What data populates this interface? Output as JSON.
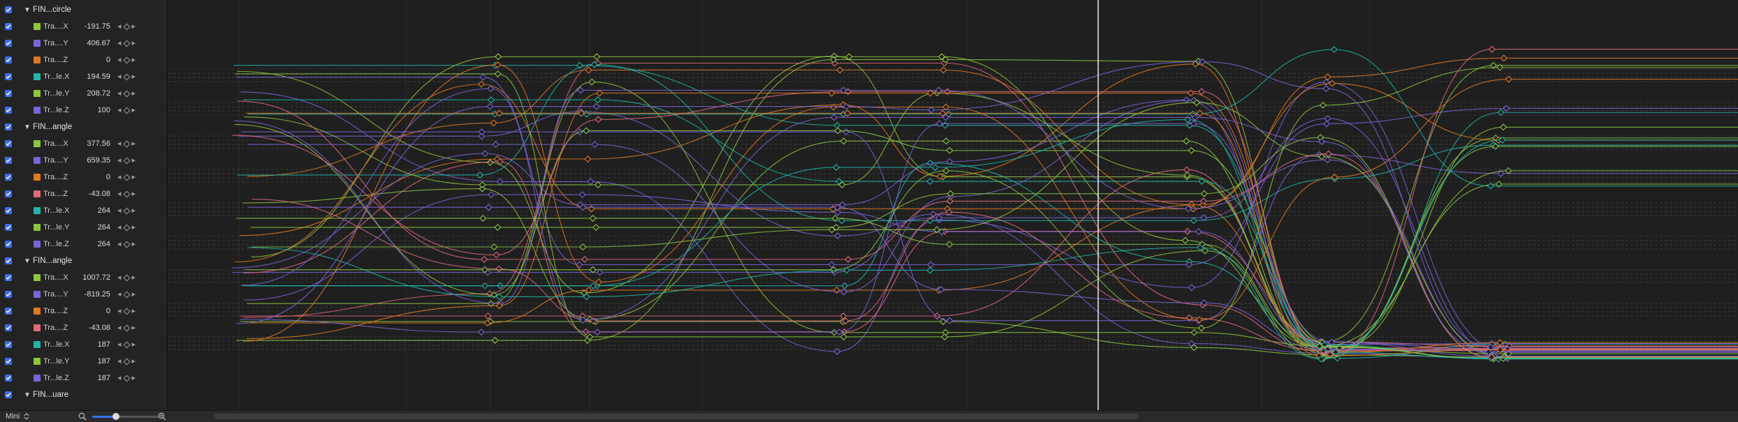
{
  "sidebar": {
    "rows": [
      {
        "kind": "group",
        "label": "FIN...circle"
      },
      {
        "kind": "param",
        "label": "Tra....X",
        "value": "-191.75",
        "color": "#8cc63e"
      },
      {
        "kind": "param",
        "label": "Tra....Y",
        "value": "406.67",
        "color": "#7b63d9"
      },
      {
        "kind": "param",
        "label": "Tra....Z",
        "value": "0",
        "color": "#e07a22"
      },
      {
        "kind": "param",
        "label": "Tr...le.X",
        "value": "194.59",
        "color": "#1fb5a7"
      },
      {
        "kind": "param",
        "label": "Tr...le.Y",
        "value": "208.72",
        "color": "#8cc63e"
      },
      {
        "kind": "param",
        "label": "Tr...le.Z",
        "value": "100",
        "color": "#7b63d9"
      },
      {
        "kind": "group",
        "label": "FIN...angle"
      },
      {
        "kind": "param",
        "label": "Tra....X",
        "value": "377.56",
        "color": "#8cc63e"
      },
      {
        "kind": "param",
        "label": "Tra....Y",
        "value": "659.35",
        "color": "#7b63d9"
      },
      {
        "kind": "param",
        "label": "Tra....Z",
        "value": "0",
        "color": "#e07a22"
      },
      {
        "kind": "param",
        "label": "Tra....Z",
        "value": "-43.08",
        "color": "#e06a7a"
      },
      {
        "kind": "param",
        "label": "Tr...le.X",
        "value": "264",
        "color": "#1fb5a7"
      },
      {
        "kind": "param",
        "label": "Tr...le.Y",
        "value": "264",
        "color": "#8cc63e"
      },
      {
        "kind": "param",
        "label": "Tr...le.Z",
        "value": "264",
        "color": "#7b63d9"
      },
      {
        "kind": "group",
        "label": "FIN...angle"
      },
      {
        "kind": "param",
        "label": "Tra....X",
        "value": "1007.72",
        "color": "#8cc63e"
      },
      {
        "kind": "param",
        "label": "Tra....Y",
        "value": "-819.25",
        "color": "#7b63d9"
      },
      {
        "kind": "param",
        "label": "Tra....Z",
        "value": "0",
        "color": "#e07a22"
      },
      {
        "kind": "param",
        "label": "Tra....Z",
        "value": "-43.08",
        "color": "#e06a7a"
      },
      {
        "kind": "param",
        "label": "Tr...le.X",
        "value": "187",
        "color": "#1fb5a7"
      },
      {
        "kind": "param",
        "label": "Tr...le.Y",
        "value": "187",
        "color": "#8cc63e"
      },
      {
        "kind": "param",
        "label": "Tr...le.Z",
        "value": "187",
        "color": "#7b63d9"
      },
      {
        "kind": "group",
        "label": "FIN...uare"
      }
    ]
  },
  "bottombar": {
    "mode": "Mini",
    "zoom_level": 0.35
  },
  "colors": {
    "green": "#8cc63e",
    "purple": "#7b63d9",
    "orange": "#e07a22",
    "teal": "#1fb5a7",
    "pink": "#e06a7a",
    "accent": "#3b6ff0"
  }
}
